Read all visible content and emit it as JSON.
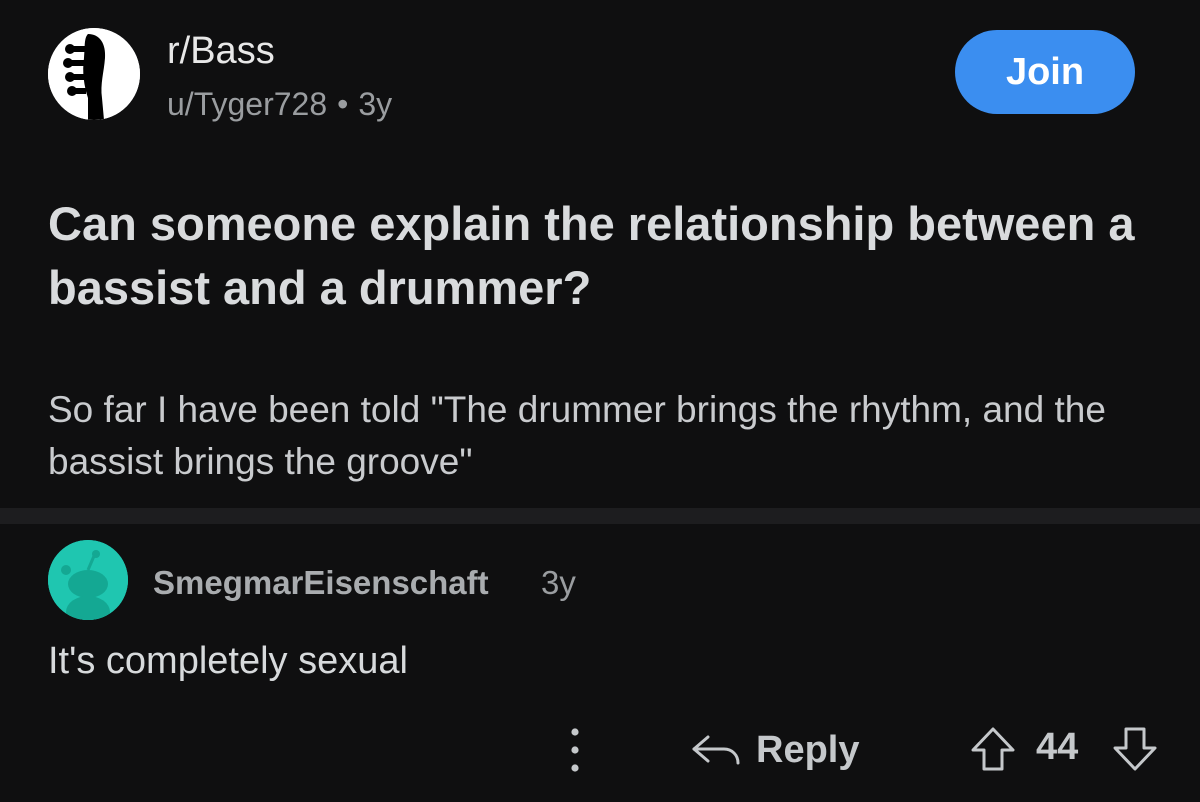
{
  "post": {
    "subreddit": "r/Bass",
    "author": "u/Tyger728",
    "separator": "•",
    "age": "3y",
    "join_label": "Join",
    "title": "Can someone explain the relationship between a bassist and a drummer?",
    "body": "So far I have been told \"The drummer brings the rhythm, and the bassist brings the groove\""
  },
  "comment": {
    "author": "SmegmarEisenschaft",
    "age": "3y",
    "text": "It's completely sexual",
    "more_icon": "vertical-ellipsis-icon",
    "reply_label": "Reply",
    "reply_icon": "reply-arrow-icon",
    "score": "44",
    "upvote_icon": "arrow-up-outline-icon",
    "downvote_icon": "arrow-down-outline-icon"
  },
  "colors": {
    "background": "#0f0f10",
    "divider": "#1d1d1f",
    "join_button": "#3b8ef0",
    "avatar_teal": "#1fc6b0"
  }
}
